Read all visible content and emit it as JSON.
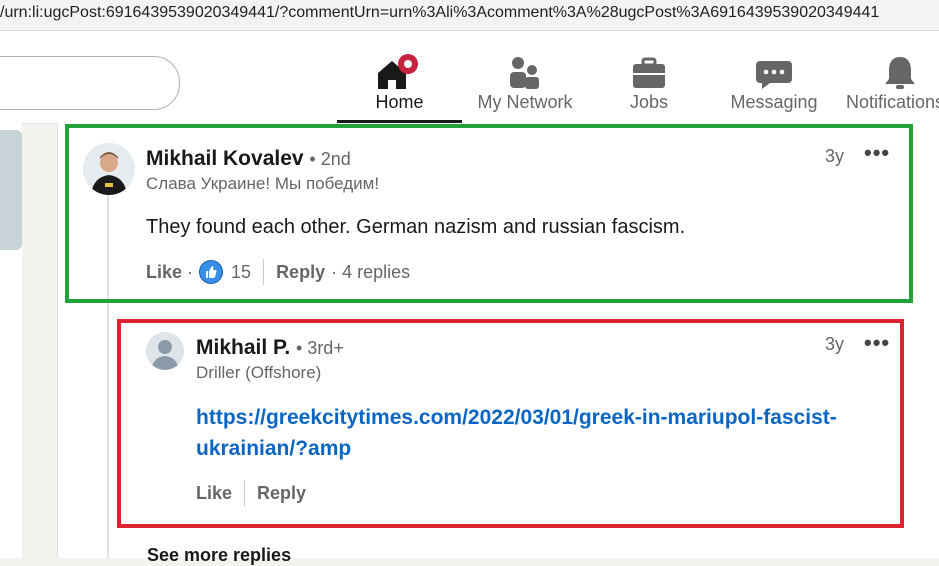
{
  "browser": {
    "url": "/urn:li:ugcPost:6916439539020349441/?commentUrn=urn%3Ali%3Acomment%3A%28ugcPost%3A6916439539020349441"
  },
  "nav": {
    "items": [
      {
        "label": "Home",
        "icon": "home-icon"
      },
      {
        "label": "My Network",
        "icon": "network-icon"
      },
      {
        "label": "Jobs",
        "icon": "briefcase-icon"
      },
      {
        "label": "Messaging",
        "icon": "messaging-icon"
      },
      {
        "label": "Notifications",
        "icon": "bell-icon"
      }
    ],
    "accent": "#c6243e"
  },
  "comment": {
    "author": "Mikhail Kovalev",
    "degree": "• 2nd",
    "headline": "Слава Украине! Мы победим!",
    "time": "3y",
    "more": "•••",
    "text": "They found each other. German nazism and russian fascism.",
    "like_label": "Like",
    "like_sep": "·",
    "reaction_count": "15",
    "reply_label": "Reply",
    "replies_text": "· 4 replies",
    "highlight_color": "#1fa33b"
  },
  "reply": {
    "author": "Mikhail P.",
    "degree": "• 3rd+",
    "headline": "Driller (Offshore)",
    "time": "3y",
    "more": "•••",
    "link_line1": "https://greekcitytimes.com/2022/03/01/greek-in-mariupol-fascist-",
    "link_line2": "ukrainian/?amp",
    "like_label": "Like",
    "reply_label": "Reply",
    "highlight_color": "#db2430"
  },
  "see_more": "See more replies"
}
